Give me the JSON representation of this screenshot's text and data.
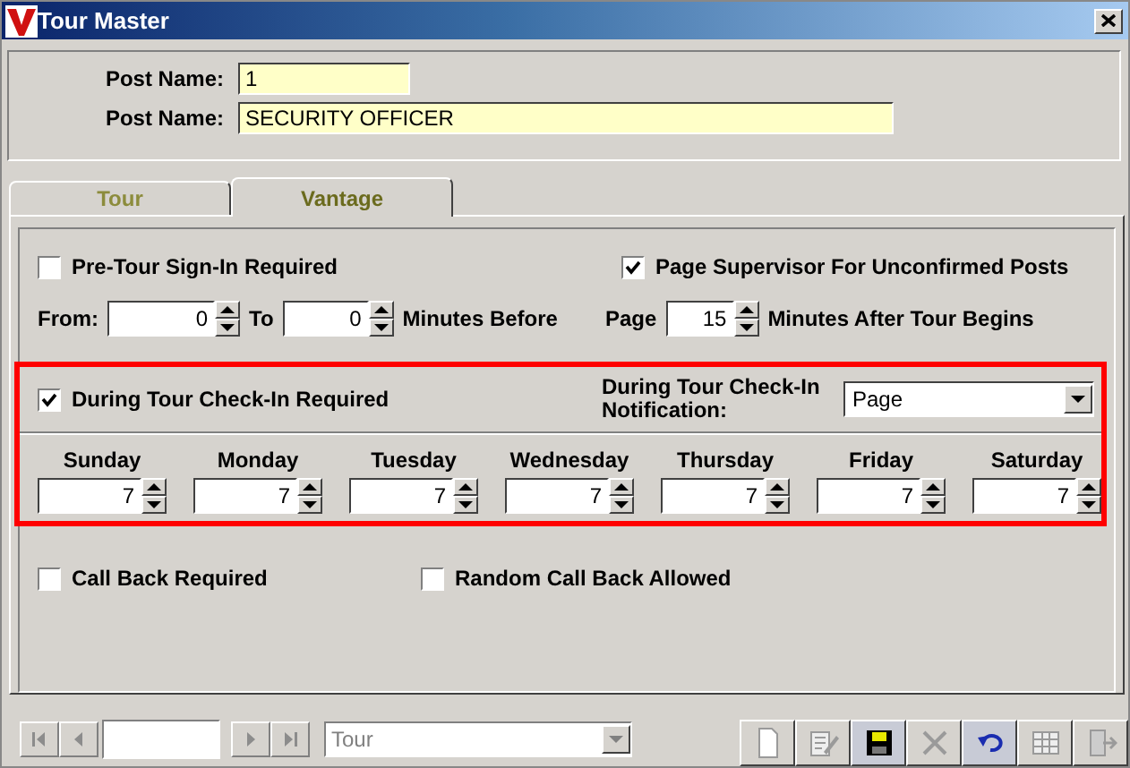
{
  "window": {
    "title": "Tour Master"
  },
  "header": {
    "fields": [
      {
        "label": "Post Name:",
        "value": "1",
        "kind": "short"
      },
      {
        "label": "Post Name:",
        "value": "SECURITY OFFICER",
        "kind": "long"
      }
    ]
  },
  "tabs": [
    {
      "label": "Tour",
      "selected": false
    },
    {
      "label": "Vantage",
      "selected": true
    }
  ],
  "pre_tour": {
    "checkbox": {
      "label": "Pre-Tour Sign-In Required",
      "checked": false
    },
    "from_label": "From:",
    "from": "0",
    "to_label": "To",
    "to": "0",
    "unit": "Minutes Before"
  },
  "supervisor": {
    "checkbox": {
      "label": "Page Supervisor For Unconfirmed Posts",
      "checked": true
    },
    "page_label": "Page",
    "page": "15",
    "unit": "Minutes After Tour Begins"
  },
  "during_tour": {
    "checkbox": {
      "label": "During Tour Check-In Required",
      "checked": true
    },
    "notification_label": "During Tour Check-In Notification:",
    "notification": "Page",
    "days": [
      {
        "day": "Sunday",
        "value": "7"
      },
      {
        "day": "Monday",
        "value": "7"
      },
      {
        "day": "Tuesday",
        "value": "7"
      },
      {
        "day": "Wednesday",
        "value": "7"
      },
      {
        "day": "Thursday",
        "value": "7"
      },
      {
        "day": "Friday",
        "value": "7"
      },
      {
        "day": "Saturday",
        "value": "7"
      }
    ]
  },
  "callback": [
    {
      "label": "Call Back Required",
      "checked": false
    },
    {
      "label": "Random Call Back Allowed",
      "checked": false
    }
  ],
  "toolbar": {
    "record_type": "Tour",
    "actions": [
      {
        "kind": "new",
        "disabled": true
      },
      {
        "kind": "edit",
        "disabled": true
      },
      {
        "kind": "save",
        "disabled": false
      },
      {
        "kind": "delete",
        "disabled": true
      },
      {
        "kind": "undo",
        "disabled": false
      },
      {
        "kind": "grid",
        "disabled": true
      },
      {
        "kind": "exit",
        "disabled": true
      }
    ]
  }
}
